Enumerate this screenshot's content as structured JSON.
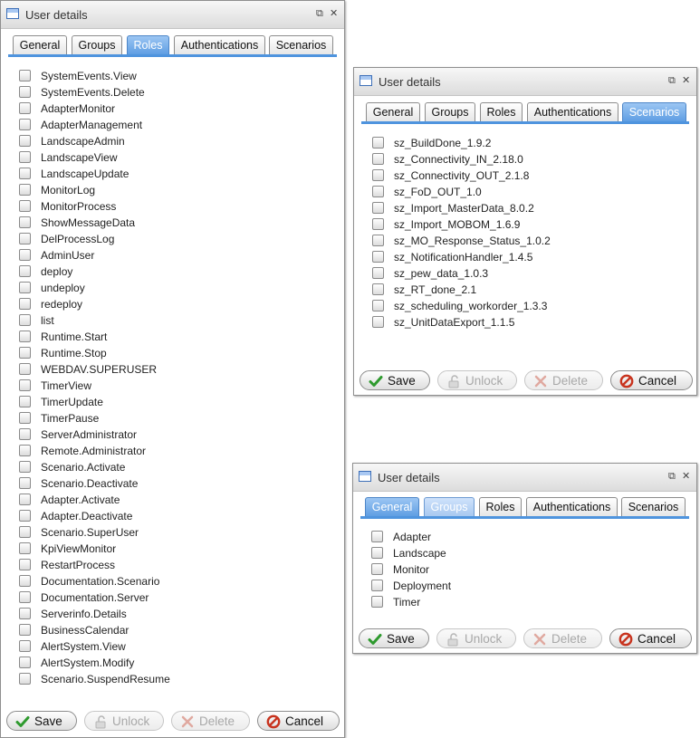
{
  "window_title": "User details",
  "tab_labels": [
    "General",
    "Groups",
    "Roles",
    "Authentications",
    "Scenarios"
  ],
  "buttons": {
    "save": "Save",
    "unlock": "Unlock",
    "delete": "Delete",
    "cancel": "Cancel"
  },
  "title_buttons": {
    "restore": "⧉",
    "close": "✕"
  },
  "roles_dialog": {
    "active_tab": "Roles",
    "items": [
      "SystemEvents.View",
      "SystemEvents.Delete",
      "AdapterMonitor",
      "AdapterManagement",
      "LandscapeAdmin",
      "LandscapeView",
      "LandscapeUpdate",
      "MonitorLog",
      "MonitorProcess",
      "ShowMessageData",
      "DelProcessLog",
      "AdminUser",
      "deploy",
      "undeploy",
      "redeploy",
      "list",
      "Runtime.Start",
      "Runtime.Stop",
      "WEBDAV.SUPERUSER",
      "TimerView",
      "TimerUpdate",
      "TimerPause",
      "ServerAdministrator",
      "Remote.Administrator",
      "Scenario.Activate",
      "Scenario.Deactivate",
      "Adapter.Activate",
      "Adapter.Deactivate",
      "Scenario.SuperUser",
      "KpiViewMonitor",
      "RestartProcess",
      "Documentation.Scenario",
      "Documentation.Server",
      "Serverinfo.Details",
      "BusinessCalendar",
      "AlertSystem.View",
      "AlertSystem.Modify",
      "Scenario.SuspendResume"
    ]
  },
  "scenarios_dialog": {
    "active_tab": "Scenarios",
    "items": [
      "sz_BuildDone_1.9.2",
      "sz_Connectivity_IN_2.18.0",
      "sz_Connectivity_OUT_2.1.8",
      "sz_FoD_OUT_1.0",
      "sz_Import_MasterData_8.0.2",
      "sz_Import_MOBOM_1.6.9",
      "sz_MO_Response_Status_1.0.2",
      "sz_NotificationHandler_1.4.5",
      "sz_pew_data_1.0.3",
      "sz_RT_done_2.1",
      "sz_scheduling_workorder_1.3.3",
      "sz_UnitDataExport_1.1.5"
    ]
  },
  "groups_dialog": {
    "active_tab": "General",
    "hover_tab": "Groups",
    "items": [
      "Adapter",
      "Landscape",
      "Monitor",
      "Deployment",
      "Timer"
    ]
  },
  "colors": {
    "tab_active": "#5f9ee3",
    "tab_line": "#4f94de",
    "save_check": "#2e9a2e",
    "cancel_red": "#c8331e"
  }
}
